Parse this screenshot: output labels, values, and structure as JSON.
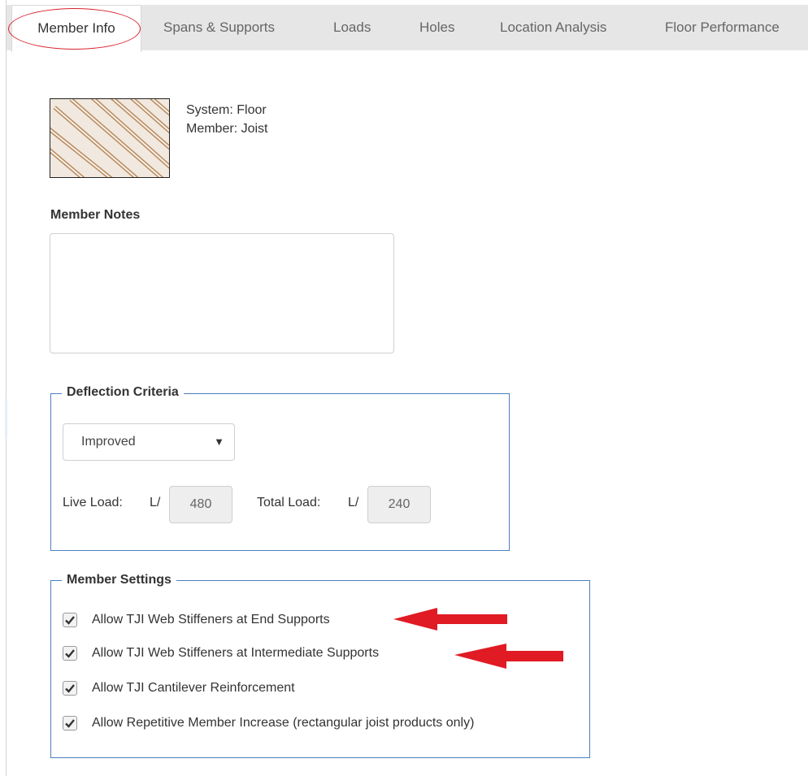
{
  "tabs": [
    {
      "label": "Member Info",
      "active": true
    },
    {
      "label": "Spans & Supports",
      "active": false
    },
    {
      "label": "Loads",
      "active": false
    },
    {
      "label": "Holes",
      "active": false
    },
    {
      "label": "Location Analysis",
      "active": false
    },
    {
      "label": "Floor Performance",
      "active": false
    }
  ],
  "member": {
    "system": "System: Floor",
    "member": "Member: Joist"
  },
  "notes": {
    "heading": "Member Notes",
    "value": ""
  },
  "deflection": {
    "legend": "Deflection Criteria",
    "selected": "Improved",
    "live_label": "Live Load:",
    "live_prefix": "L/",
    "live_value": "480",
    "total_label": "Total Load:",
    "total_prefix": "L/",
    "total_value": "240"
  },
  "settings": {
    "legend": "Member Settings",
    "options": [
      {
        "label": "Allow TJI Web Stiffeners at End Supports",
        "checked": true
      },
      {
        "label": "Allow TJI Web Stiffeners at Intermediate Supports",
        "checked": true
      },
      {
        "label": "Allow TJI Cantilever Reinforcement",
        "checked": true
      },
      {
        "label": "Allow Repetitive Member Increase (rectangular joist products only)",
        "checked": true
      }
    ]
  },
  "colors": {
    "annotation_red": "#e01b24",
    "fieldset_border": "#4a7fc1",
    "tab_bar": "#e6e6e6"
  },
  "icons": {
    "thumbnail": "joist-image",
    "select_caret": "caret-down-icon",
    "checkbox": "checkmark-icon",
    "annotation": "red-arrow-icon"
  }
}
